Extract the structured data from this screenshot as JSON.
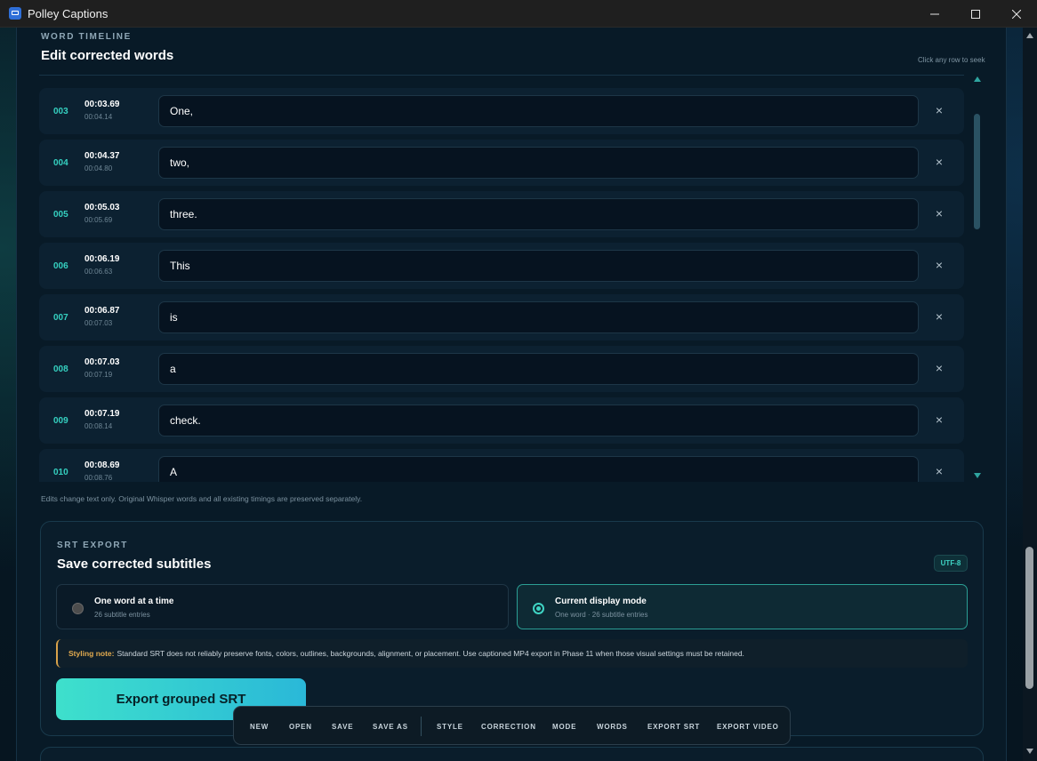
{
  "window": {
    "title": "Polley Captions"
  },
  "word_timeline": {
    "eyebrow": "WORD TIMELINE",
    "heading": "Edit corrected words",
    "hint": "Click any row to seek",
    "note": "Edits change text only. Original Whisper words and all existing timings are preserved separately.",
    "rows": [
      {
        "index": "003",
        "start": "00:03.69",
        "end": "00:04.14",
        "word": "One,"
      },
      {
        "index": "004",
        "start": "00:04.37",
        "end": "00:04.80",
        "word": "two,"
      },
      {
        "index": "005",
        "start": "00:05.03",
        "end": "00:05.69",
        "word": "three."
      },
      {
        "index": "006",
        "start": "00:06.19",
        "end": "00:06.63",
        "word": "This"
      },
      {
        "index": "007",
        "start": "00:06.87",
        "end": "00:07.03",
        "word": "is"
      },
      {
        "index": "008",
        "start": "00:07.03",
        "end": "00:07.19",
        "word": "a"
      },
      {
        "index": "009",
        "start": "00:07.19",
        "end": "00:08.14",
        "word": "check."
      },
      {
        "index": "010",
        "start": "00:08.69",
        "end": "00:08.76",
        "word": "A"
      }
    ],
    "delete_glyph": "×"
  },
  "srt_export": {
    "eyebrow": "SRT EXPORT",
    "heading": "Save corrected subtitles",
    "badge": "UTF-8",
    "options": [
      {
        "title": "One word at a time",
        "subtitle": "26 subtitle entries",
        "selected": false
      },
      {
        "title": "Current display mode",
        "subtitle": "One word · 26 subtitle entries",
        "selected": true
      }
    ],
    "styling_note_label": "Styling note:",
    "styling_note_text": "Standard SRT does not reliably preserve fonts, colors, outlines, backgrounds, alignment, or placement. Use captioned MP4 export in Phase 11 when those visual settings must be retained.",
    "export_button": "Export grouped SRT"
  },
  "toolbar": {
    "items": [
      "NEW",
      "OPEN",
      "SAVE",
      "SAVE AS",
      "STYLE",
      "CORRECTION",
      "MODE",
      "WORDS",
      "EXPORT SRT",
      "EXPORT VIDEO"
    ]
  },
  "colors": {
    "accent": "#3fd4c4",
    "warning": "#e2ab4f",
    "background": "#081a27"
  }
}
